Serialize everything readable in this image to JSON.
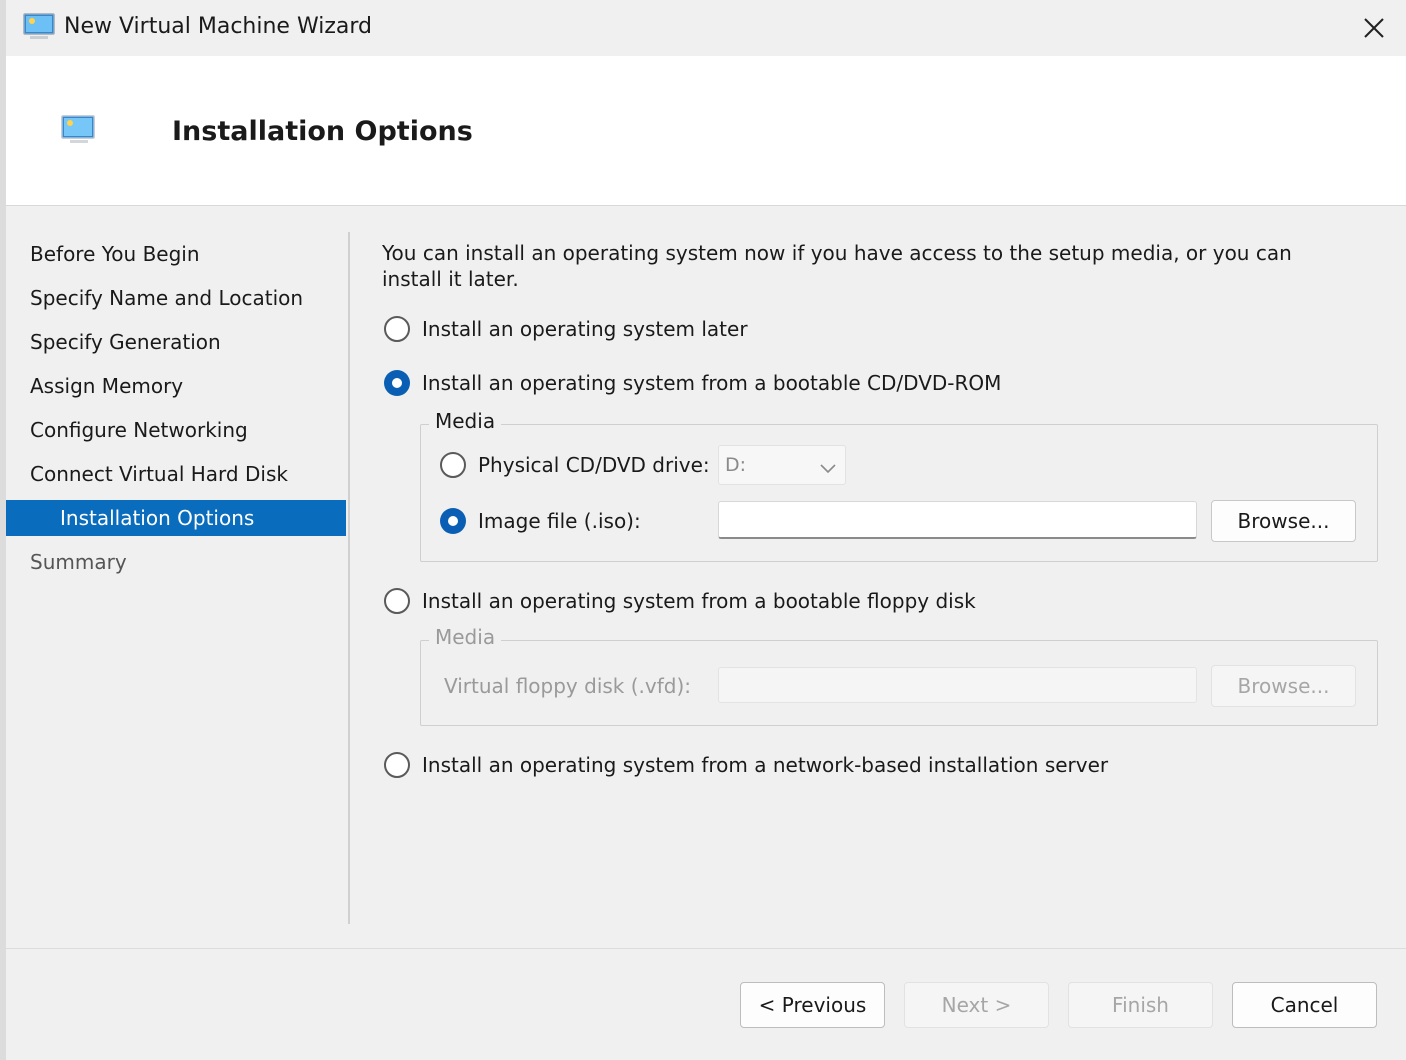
{
  "window": {
    "title": "New Virtual Machine Wizard"
  },
  "header": {
    "title": "Installation Options"
  },
  "nav": {
    "items": [
      {
        "label": "Before You Begin",
        "state": "normal"
      },
      {
        "label": "Specify Name and Location",
        "state": "normal"
      },
      {
        "label": "Specify Generation",
        "state": "normal"
      },
      {
        "label": "Assign Memory",
        "state": "normal"
      },
      {
        "label": "Configure Networking",
        "state": "normal"
      },
      {
        "label": "Connect Virtual Hard Disk",
        "state": "normal"
      },
      {
        "label": "Installation Options",
        "state": "active"
      },
      {
        "label": "Summary",
        "state": "muted"
      }
    ]
  },
  "content": {
    "intro": "You can install an operating system now if you have access to the setup media, or you can install it later.",
    "options": {
      "later": {
        "label": "Install an operating system later",
        "checked": false
      },
      "cd": {
        "label": "Install an operating system from a bootable CD/DVD-ROM",
        "checked": true
      },
      "floppy": {
        "label": "Install an operating system from a bootable floppy disk",
        "checked": false
      },
      "network": {
        "label": "Install an operating system from a network-based installation server",
        "checked": false
      }
    },
    "cd_media": {
      "legend": "Media",
      "physical_label": "Physical CD/DVD drive:",
      "physical_checked": false,
      "drive_value": "D:",
      "image_label": "Image file (.iso):",
      "image_checked": true,
      "image_value": "",
      "browse_label": "Browse..."
    },
    "floppy_media": {
      "legend": "Media",
      "vfd_label": "Virtual floppy disk (.vfd):",
      "vfd_value": "",
      "browse_label": "Browse..."
    }
  },
  "footer": {
    "previous": "< Previous",
    "next": "Next >",
    "finish": "Finish",
    "cancel": "Cancel"
  },
  "colors": {
    "accent": "#0a6cbc",
    "radio_checked": "#0a5fb4"
  }
}
